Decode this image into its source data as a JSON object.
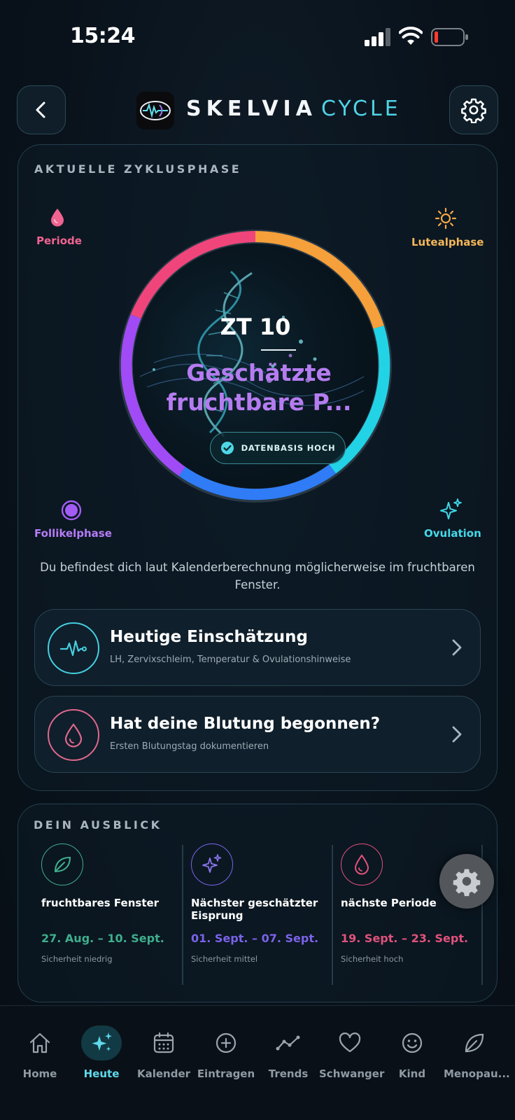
{
  "status_bar": {
    "time": "15:24"
  },
  "header": {
    "brand_name": "SKELVIA",
    "brand_suffix": "CYCLE",
    "back_icon": "chevron-left-icon",
    "settings_icon": "gear-icon"
  },
  "phase_card": {
    "title": "AKTUELLE ZYKLUSPHASE",
    "labels": {
      "periode": "Periode",
      "luteal": "Lutealphase",
      "follikel": "Follikelphase",
      "ovulation": "Ovulation"
    },
    "cycle_day": "ZT 10",
    "phase_name_line1": "Geschätzte",
    "phase_name_line2": "fruchtbare P...",
    "data_badge": "DATENBASIS HOCH",
    "description": "Du befindest dich laut Kalenderberechnung möglicherweise im fruchtbaren Fenster.",
    "colors": {
      "periode": "#f0457b",
      "luteal": "#f5a03a",
      "ovulation": "#22d3e6",
      "follikel_blue": "#2f7cf6",
      "follikel": "#a04bf5"
    }
  },
  "actions": [
    {
      "title": "Heutige Einschätzung",
      "subtitle": "LH, Zervixschleim, Temperatur & Ovulationshinweise",
      "icon": "heartbeat-icon"
    },
    {
      "title": "Hat deine Blutung begonnen?",
      "subtitle": "Ersten Blutungstag dokumentieren",
      "icon": "droplet-icon"
    }
  ],
  "outlook": {
    "title": "DEIN AUSBLICK",
    "items": [
      {
        "title": "fruchtbares Fenster",
        "date": "27. Aug. – 10. Sept.",
        "confidence": "Sicherheit niedrig",
        "color": "#3fae8c",
        "icon": "leaf-icon"
      },
      {
        "title": "Nächster geschätzter Eisprung",
        "date": "01. Sept. – 07. Sept.",
        "confidence": "Sicherheit mittel",
        "color": "#7a63e8",
        "icon": "sparkles-icon"
      },
      {
        "title": "nächste Periode",
        "date": "19. Sept. – 23. Sept.",
        "confidence": "Sicherheit hoch",
        "color": "#e0527c",
        "icon": "droplet-icon"
      }
    ]
  },
  "nav": {
    "items": [
      {
        "label": "Home",
        "icon": "home-icon"
      },
      {
        "label": "Heute",
        "icon": "sparkles-icon",
        "active": true
      },
      {
        "label": "Kalender",
        "icon": "calendar-icon"
      },
      {
        "label": "Eintragen",
        "icon": "plus-circle-icon"
      },
      {
        "label": "Trends",
        "icon": "trend-icon"
      },
      {
        "label": "Schwanger",
        "icon": "heart-icon"
      },
      {
        "label": "Kind",
        "icon": "smiley-icon"
      },
      {
        "label": "Menopau...",
        "icon": "leaf-icon"
      }
    ]
  }
}
